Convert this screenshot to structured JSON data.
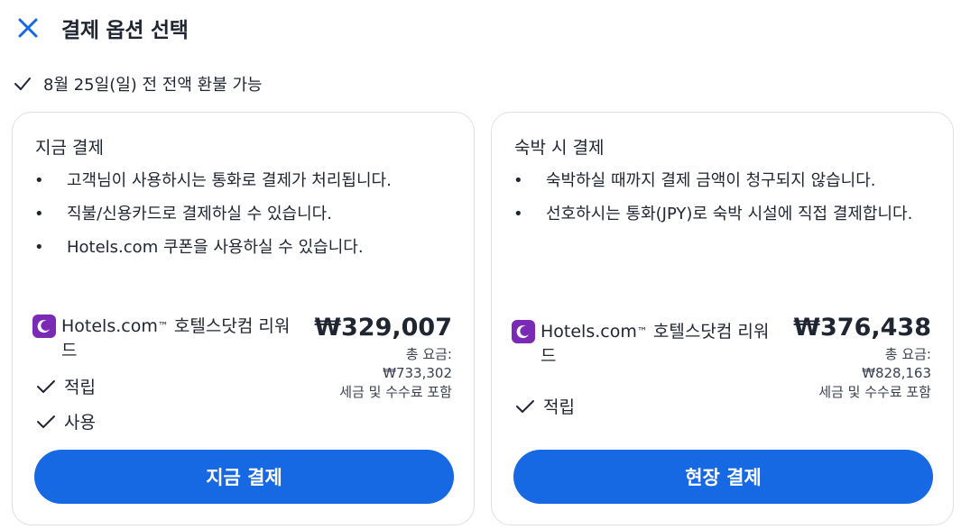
{
  "header": {
    "title": "결제 옵션 선택",
    "close_icon": "close-icon"
  },
  "refund": {
    "text": "8월 25일(일) 전 전액 환불 가능"
  },
  "pay_now": {
    "title": "지금 결제",
    "bullets": [
      "고객님이 사용하시는 통화로 결제가 처리됩니다.",
      "직불/신용카드로 결제하실 수 있습니다.",
      "Hotels.com 쿠폰을 사용하실 수 있습니다."
    ],
    "reward_label_line1": "Hotels.com",
    "reward_tm": "™",
    "reward_label_rest": " 호텔스닷컴 리워드",
    "price": "₩329,007",
    "total_label": "총 요금:",
    "total_value": "₩733,302",
    "tax_note": "세금 및 수수료 포함",
    "earn_label": "적립",
    "use_label": "사용",
    "button_label": "지금 결제"
  },
  "pay_later": {
    "title": "숙박 시 결제",
    "bullets": [
      "숙박하실 때까지 결제 금액이 청구되지 않습니다.",
      "선호하시는 통화(JPY)로 숙박 시설에 직접 결제합니다."
    ],
    "reward_label_line1": "Hotels.com",
    "reward_tm": "™",
    "reward_label_rest": " 호텔스닷컴 리워드",
    "price": "₩376,438",
    "total_label": "총 요금:",
    "total_value": "₩828,163",
    "tax_note": "세금 및 수수료 포함",
    "earn_label": "적립",
    "button_label": "현장 결제"
  },
  "colors": {
    "accent": "#1668e3",
    "reward_purple": "#7b2ab5",
    "text": "#1f2531",
    "border": "#dfe0e4"
  }
}
